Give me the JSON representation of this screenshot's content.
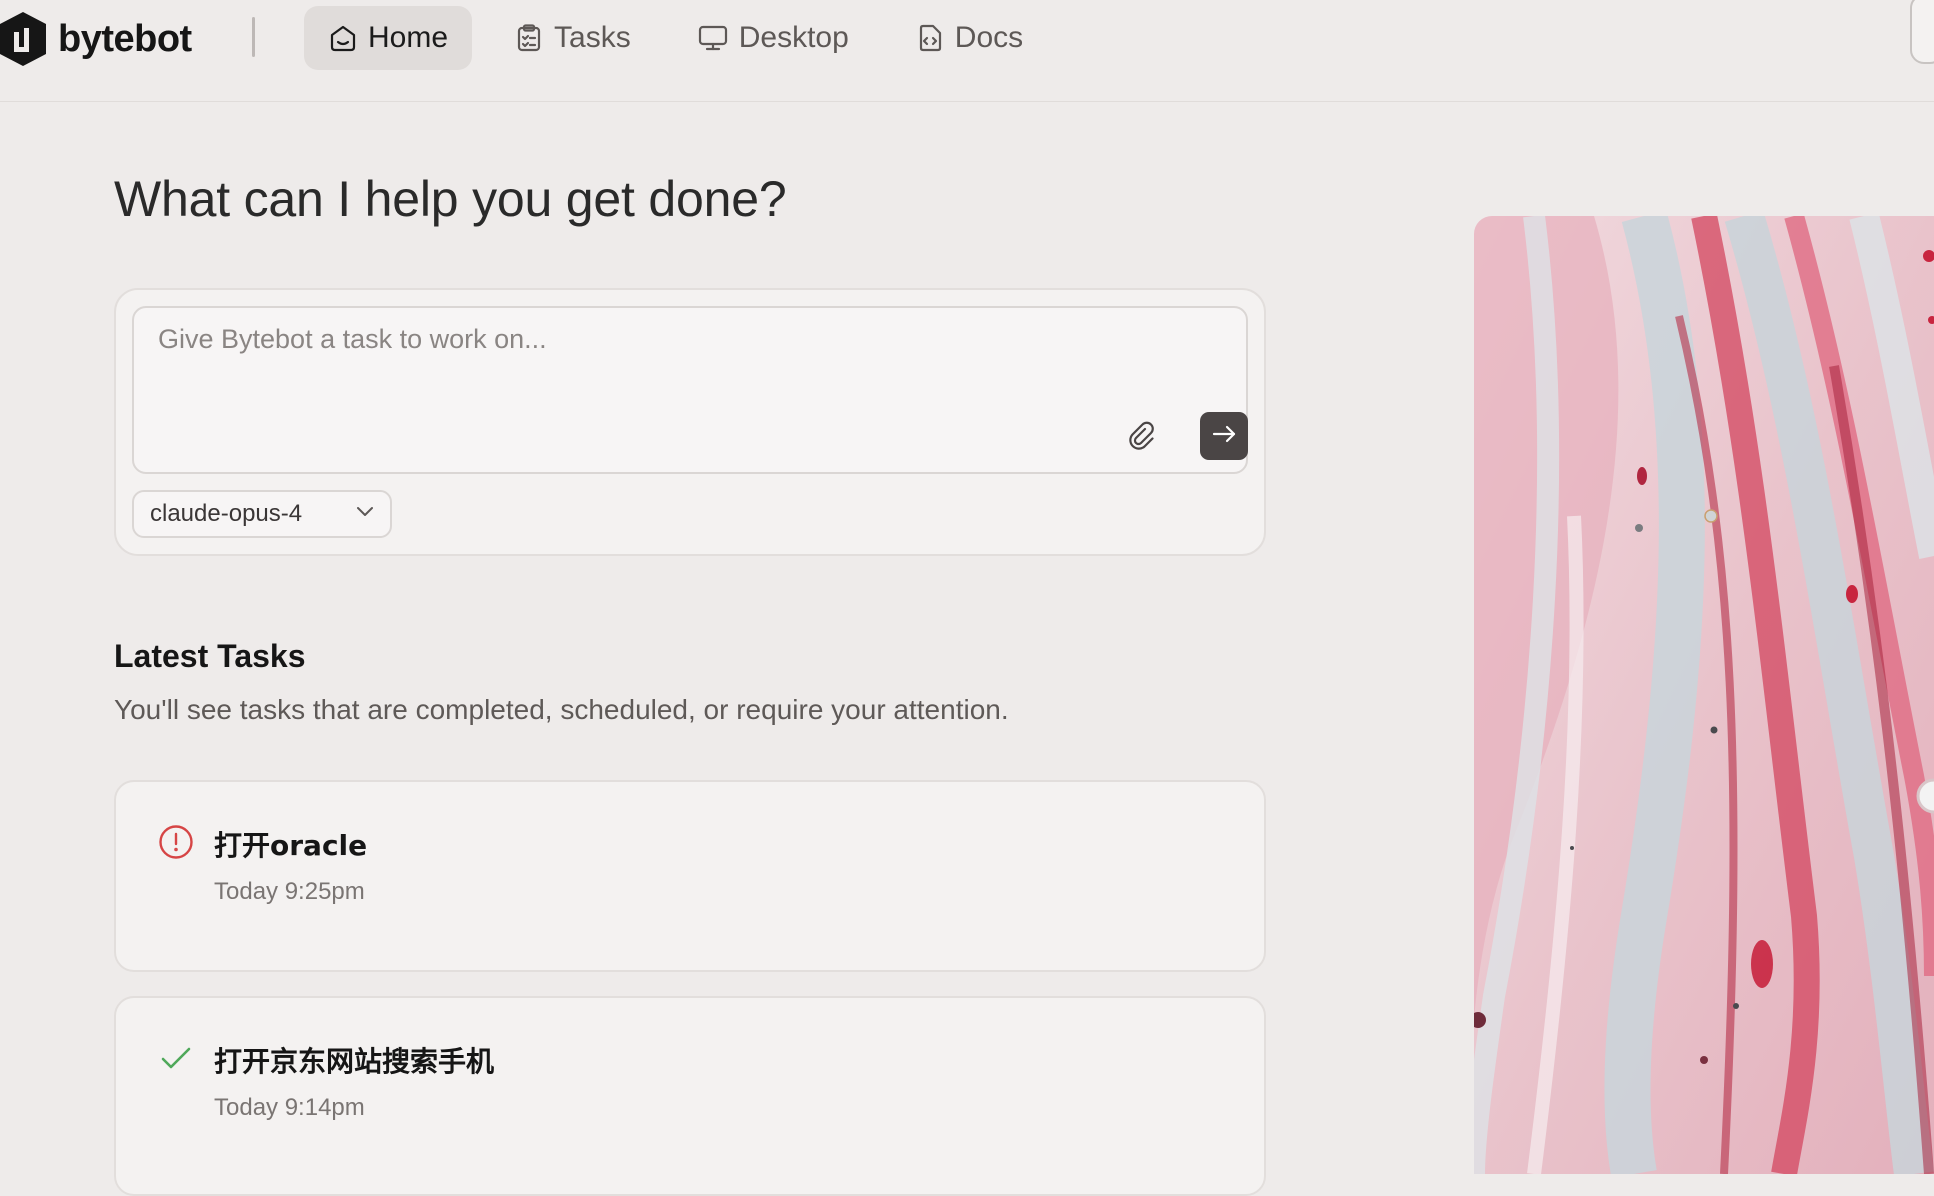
{
  "brand": {
    "name": "bytebot"
  },
  "nav": {
    "items": [
      {
        "label": "Home",
        "icon": "home-icon",
        "active": true
      },
      {
        "label": "Tasks",
        "icon": "clipboard-icon",
        "active": false
      },
      {
        "label": "Desktop",
        "icon": "monitor-icon",
        "active": false
      },
      {
        "label": "Docs",
        "icon": "doc-code-icon",
        "active": false
      }
    ]
  },
  "hero": {
    "title": "What can I help you get done?"
  },
  "composer": {
    "placeholder": "Give Bytebot a task to work on...",
    "value": "",
    "attach_icon": "paperclip-icon",
    "send_icon": "arrow-right-icon",
    "model": {
      "selected": "claude-opus-4",
      "icon": "chevron-down-icon"
    }
  },
  "latest": {
    "title": "Latest Tasks",
    "subtitle": "You'll see tasks that are completed, scheduled, or require your attention.",
    "tasks": [
      {
        "title": "打开oracle",
        "time": "Today 9:25pm",
        "status": "needs-attention",
        "status_icon": "alert-circle-icon",
        "status_color": "#D64545"
      },
      {
        "title": "打开京东网站搜索手机",
        "time": "Today 9:14pm",
        "status": "completed",
        "status_icon": "check-icon",
        "status_color": "#4FA85A"
      }
    ]
  },
  "colors": {
    "background": "#EEEBEA",
    "card": "#F4F2F1",
    "accent_dark": "#4A4545",
    "nav_active": "#E0DCDA"
  }
}
